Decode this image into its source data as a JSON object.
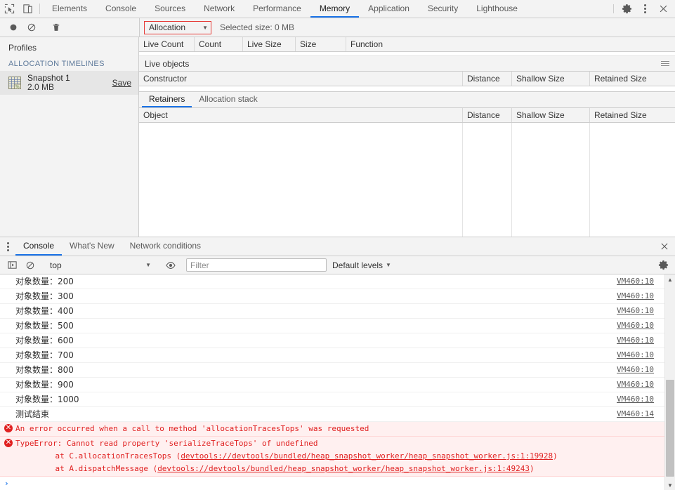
{
  "window": {
    "title": "Chrome DevTools — Memory",
    "accent": "#1a73e8",
    "error_color": "#e02020",
    "toolbar_bg": "#f3f3f3"
  },
  "main_tabbar": {
    "inspect_icon": "inspect-element-icon",
    "device_icon": "device-toolbar-icon",
    "tabs": [
      {
        "label": "Elements",
        "active": false
      },
      {
        "label": "Console",
        "active": false
      },
      {
        "label": "Sources",
        "active": false
      },
      {
        "label": "Network",
        "active": false
      },
      {
        "label": "Performance",
        "active": false
      },
      {
        "label": "Memory",
        "active": true
      },
      {
        "label": "Application",
        "active": false
      },
      {
        "label": "Security",
        "active": false
      },
      {
        "label": "Lighthouse",
        "active": false
      }
    ],
    "settings_icon": "gear-icon",
    "more_icon": "kebab-menu-icon",
    "close_icon": "close-icon"
  },
  "memory_panel": {
    "toolbar": {
      "record_icon": "record-circle-icon",
      "clear_icon": "clear-no-entry-icon",
      "delete_icon": "trash-icon",
      "view_select_value": "Allocation",
      "view_select_caret": "▼",
      "selected_size": "Selected size: 0 MB"
    },
    "sidebar": {
      "title": "Profiles",
      "group_header": "ALLOCATION TIMELINES",
      "snapshot": {
        "icon": "heap-snapshot-icon",
        "name": "Snapshot 1",
        "size": "2.0 MB",
        "save_label": "Save"
      }
    },
    "allocation_grid": {
      "columns": [
        "Live Count",
        "Count",
        "Live Size",
        "Size",
        "Function"
      ]
    },
    "live_objects": {
      "section_label": "Live objects",
      "menu_icon": "hamburger-menu-icon",
      "columns": [
        "Constructor",
        "Distance",
        "Shallow Size",
        "Retained Size"
      ]
    },
    "detail": {
      "tabs": [
        {
          "label": "Retainers",
          "active": true
        },
        {
          "label": "Allocation stack",
          "active": false
        }
      ],
      "columns": [
        "Object",
        "Distance",
        "Shallow Size",
        "Retained Size"
      ]
    }
  },
  "drawer": {
    "menu_icon": "kebab-menu-icon",
    "tabs": [
      {
        "label": "Console",
        "active": true
      },
      {
        "label": "What's New",
        "active": false
      },
      {
        "label": "Network conditions",
        "active": false
      }
    ],
    "close_icon": "close-icon",
    "toolbar": {
      "sidebar_icon": "console-sidebar-icon",
      "clear_icon": "clear-console-icon",
      "context_value": "top",
      "context_caret": "▼",
      "eye_icon": "live-expression-eye-icon",
      "filter_placeholder": "Filter",
      "filter_value": "",
      "levels_label": "Default levels",
      "levels_caret": "▼",
      "settings_icon": "gear-icon"
    },
    "messages": [
      {
        "type": "log",
        "text": "对象数量：200",
        "source": "VM460:10",
        "cjk": true
      },
      {
        "type": "log",
        "text": "对象数量：300",
        "source": "VM460:10",
        "cjk": true
      },
      {
        "type": "log",
        "text": "对象数量：400",
        "source": "VM460:10",
        "cjk": true
      },
      {
        "type": "log",
        "text": "对象数量：500",
        "source": "VM460:10",
        "cjk": true
      },
      {
        "type": "log",
        "text": "对象数量：600",
        "source": "VM460:10",
        "cjk": true
      },
      {
        "type": "log",
        "text": "对象数量：700",
        "source": "VM460:10",
        "cjk": true
      },
      {
        "type": "log",
        "text": "对象数量：800",
        "source": "VM460:10",
        "cjk": true
      },
      {
        "type": "log",
        "text": "对象数量：900",
        "source": "VM460:10",
        "cjk": true
      },
      {
        "type": "log",
        "text": "对象数量：1000",
        "source": "VM460:10",
        "cjk": true
      },
      {
        "type": "log",
        "text": "测试结束",
        "source": "VM460:14",
        "cjk": true
      }
    ],
    "errors": [
      {
        "badge": "✕",
        "text": "An error occurred when a call to method 'allocationTracesTops' was requested",
        "stack": []
      },
      {
        "badge": "✕",
        "text": "TypeError: Cannot read property 'serializeTraceTops' of undefined",
        "stack": [
          {
            "prefix": "    at C.allocationTracesTops (",
            "link": "devtools://devtools/bundled/heap_snapshot_worker/heap_snapshot_worker.js:1:19928",
            "suffix": ")"
          },
          {
            "prefix": "    at A.dispatchMessage (",
            "link": "devtools://devtools/bundled/heap_snapshot_worker/heap_snapshot_worker.js:1:49243",
            "suffix": ")"
          }
        ]
      }
    ],
    "prompt": {
      "caret": "›",
      "value": ""
    },
    "scrollbar": {
      "up_arrow": "▲",
      "down_arrow": "▼"
    }
  }
}
